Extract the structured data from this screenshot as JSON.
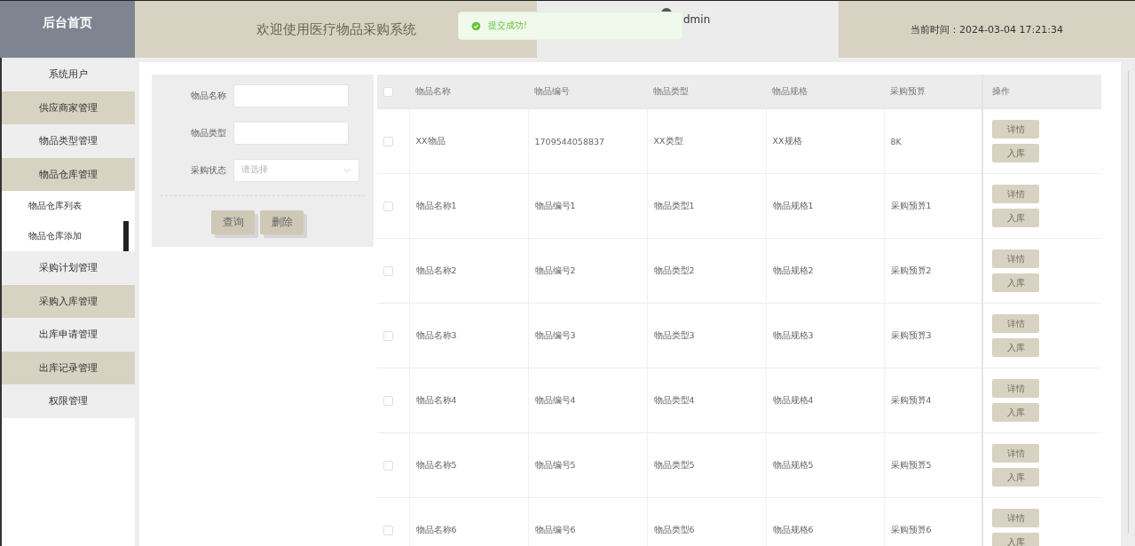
{
  "header": {
    "home": "后台首页",
    "title": "欢迎使用医疗物品采购系统",
    "user": "dmin",
    "time": "当前时间：2024-03-04 17:21:34"
  },
  "toast": {
    "text": "提交成功!"
  },
  "sidebar": {
    "items": [
      {
        "label": "系统用户",
        "selected": false
      },
      {
        "label": "供应商家管理",
        "selected": false
      },
      {
        "label": "物品类型管理",
        "selected": false
      },
      {
        "label": "物品仓库管理",
        "selected": false,
        "expanded": true,
        "children": [
          {
            "label": "物品仓库列表",
            "selected": false
          },
          {
            "label": "物品仓库添加",
            "selected": true
          }
        ]
      },
      {
        "label": "采购计划管理",
        "selected": false
      },
      {
        "label": "采购入库管理",
        "selected": false
      },
      {
        "label": "出库申请管理",
        "selected": false
      },
      {
        "label": "出库记录管理",
        "selected": false
      },
      {
        "label": "权限管理",
        "selected": false
      }
    ]
  },
  "search": {
    "fields": [
      {
        "kind": "text",
        "label": "物品名称"
      },
      {
        "kind": "text",
        "label": "物品类型"
      },
      {
        "kind": "select",
        "label": "采购状态",
        "placeholder": "请选择"
      }
    ],
    "buttons": [
      "查询",
      "删除"
    ]
  },
  "table": {
    "columns": [
      "物品名称",
      "物品编号",
      "物品类型",
      "物品规格",
      "采购预算",
      "操作"
    ],
    "select_all_checked": false,
    "rows": [
      {
        "checked": false,
        "cells": [
          "XX物品",
          "1709544058837",
          "XX类型",
          "XX规格",
          "8K"
        ],
        "actions": [
          "详情",
          "入库"
        ]
      },
      {
        "checked": false,
        "cells": [
          "物品名称1",
          "物品编号1",
          "物品类型1",
          "物品规格1",
          "采购预算1"
        ],
        "actions": [
          "详情",
          "入库"
        ]
      },
      {
        "checked": false,
        "cells": [
          "物品名称2",
          "物品编号2",
          "物品类型2",
          "物品规格2",
          "采购预算2"
        ],
        "actions": [
          "详情",
          "入库"
        ]
      },
      {
        "checked": false,
        "cells": [
          "物品名称3",
          "物品编号3",
          "物品类型3",
          "物品规格3",
          "采购预算3"
        ],
        "actions": [
          "详情",
          "入库"
        ]
      },
      {
        "checked": false,
        "cells": [
          "物品名称4",
          "物品编号4",
          "物品类型4",
          "物品规格4",
          "采购预算4"
        ],
        "actions": [
          "详情",
          "入库"
        ]
      },
      {
        "checked": false,
        "cells": [
          "物品名称5",
          "物品编号5",
          "物品类型5",
          "物品规格5",
          "采购预算5"
        ],
        "actions": [
          "详情",
          "入库"
        ]
      },
      {
        "checked": false,
        "cells": [
          "物品名称6",
          "物品编号6",
          "物品类型6",
          "物品规格6",
          "采购预算6"
        ],
        "actions": [
          "详情",
          "入库"
        ]
      }
    ]
  }
}
